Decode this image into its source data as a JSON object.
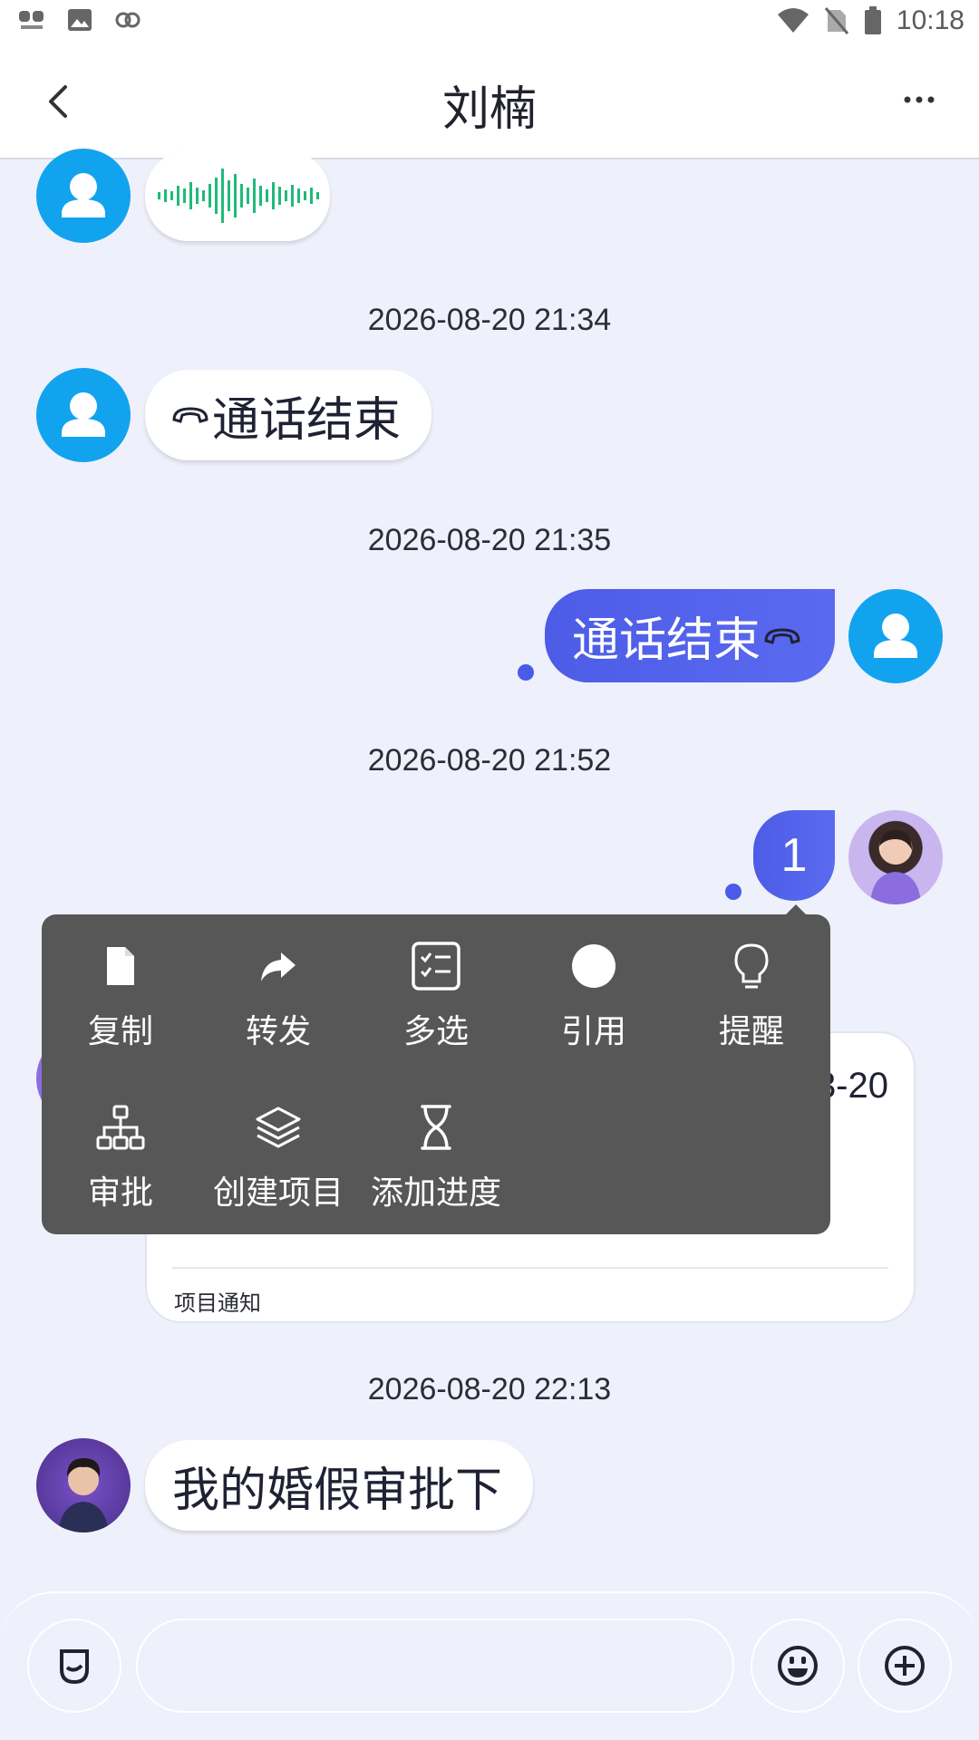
{
  "status_bar": {
    "time": "10:18",
    "notification_icons": [
      "app-icon",
      "image-icon",
      "cloud-link-icon"
    ],
    "system_icons": [
      "wifi-icon",
      "no-sim-icon",
      "battery-icon"
    ]
  },
  "header": {
    "title": "刘楠",
    "back_icon": "chevron-left-icon",
    "more_icon": "more-icon"
  },
  "messages": [
    {
      "type": "voice",
      "sender": "other"
    },
    {
      "type": "timestamp",
      "text": "2026-08-20 21:34"
    },
    {
      "type": "call",
      "sender": "other",
      "text": "通话结束"
    },
    {
      "type": "timestamp",
      "text": "2026-08-20 21:35"
    },
    {
      "type": "call",
      "sender": "me",
      "text": "通话结束"
    },
    {
      "type": "timestamp",
      "text": "2026-08-20 21:52"
    },
    {
      "type": "text",
      "sender": "me",
      "text": "1"
    },
    {
      "type": "card",
      "sender": "other",
      "partial_text": "3-20",
      "footer": "项目通知"
    },
    {
      "type": "timestamp",
      "text": "2026-08-20 22:13"
    },
    {
      "type": "text",
      "sender": "other",
      "text": "我的婚假审批下"
    }
  ],
  "timestamps": [
    "2026-08-20 21:34",
    "2026-08-20 21:35",
    "2026-08-20 21:52",
    "2026-08-20 22:13"
  ],
  "msg": {
    "call_other": "通话结束",
    "call_me": "通话结束",
    "text_me": "1",
    "card_partial": "3-20",
    "card_footer": "项目通知",
    "text_other": "我的婚假审批下"
  },
  "context_menu": {
    "row1": [
      {
        "label": "复制",
        "icon": "document-icon"
      },
      {
        "label": "转发",
        "icon": "forward-icon"
      },
      {
        "label": "多选",
        "icon": "checklist-icon"
      },
      {
        "label": "引用",
        "icon": "circle-icon"
      },
      {
        "label": "提醒",
        "icon": "bulb-icon"
      }
    ],
    "row2": [
      {
        "label": "审批",
        "icon": "org-chart-icon"
      },
      {
        "label": "创建项目",
        "icon": "layers-icon"
      },
      {
        "label": "添加进度",
        "icon": "hourglass-icon"
      }
    ]
  },
  "input_bar": {
    "voice_icon": "voice-toggle-icon",
    "placeholder": "",
    "emoji_icon": "emoji-icon",
    "add_icon": "plus-circle-icon"
  },
  "colors": {
    "background": "#eef0fb",
    "accent": "#4c5ce6",
    "avatar_default": "#12a3ee",
    "menu_bg": "#575757",
    "voice_wave": "#1fba7a"
  }
}
